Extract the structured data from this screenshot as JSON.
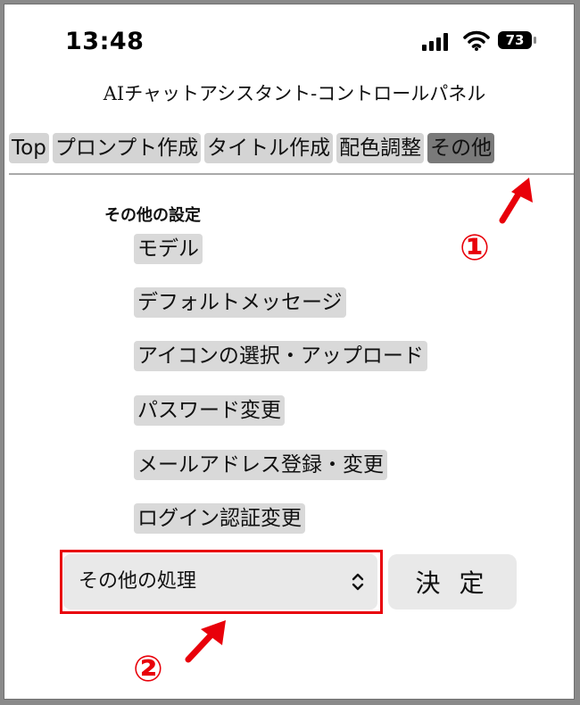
{
  "status_bar": {
    "time": "13:48",
    "battery": "73",
    "icons": [
      "signal-icon",
      "wifi-icon",
      "battery-icon"
    ]
  },
  "app_title": "AIチャットアシスタント-コントロールパネル",
  "tabs": [
    {
      "label": "Top",
      "active": false
    },
    {
      "label": "プロンプト作成",
      "active": false
    },
    {
      "label": "タイトル作成",
      "active": false
    },
    {
      "label": "配色調整",
      "active": false
    },
    {
      "label": "その他",
      "active": true
    }
  ],
  "section": {
    "title": "その他の設定",
    "items": [
      {
        "label": "モデル"
      },
      {
        "label": "デフォルトメッセージ"
      },
      {
        "label": "アイコンの選択・アップロード"
      },
      {
        "label": "パスワード変更"
      },
      {
        "label": "メールアドレス登録・変更"
      },
      {
        "label": "ログイン認証変更"
      }
    ]
  },
  "action": {
    "select_value": "その他の処理",
    "submit_label": "決 定"
  },
  "annotations": {
    "step1": "①",
    "step2": "②",
    "color": "#e8000a"
  },
  "colors": {
    "tab_bg": "#d4d4d4",
    "tab_active_bg": "#7a7a7a",
    "item_bg": "#d9d9d9",
    "control_bg": "#e9e9e9"
  }
}
